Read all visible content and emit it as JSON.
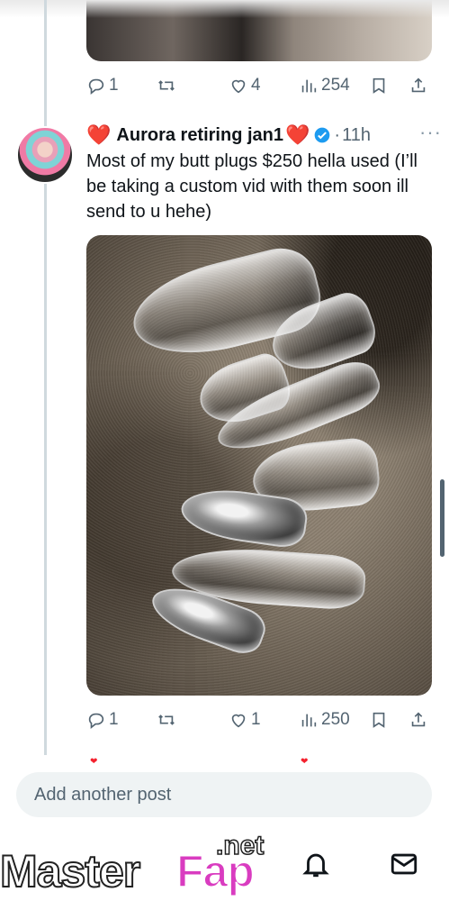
{
  "previous_post": {
    "replies": "1",
    "likes": "4",
    "views": "254"
  },
  "post": {
    "display_name": "Aurora retiring jan1",
    "name_prefix_emoji": "❤️",
    "name_suffix_emoji": "❤️",
    "verified": true,
    "separator": "·",
    "time": "11h",
    "more": "···",
    "text": "Most of my butt plugs $250 hella used (I’ll be taking a custom vid with them soon ill send to u hehe)",
    "media_alt": "photo",
    "replies": "1",
    "likes": "1",
    "views": "250"
  },
  "compose": {
    "placeholder": "Add another post"
  },
  "icons": {
    "reply": "reply-icon",
    "repost": "repost-icon",
    "like": "heart-icon",
    "views": "views-icon",
    "bookmark": "bookmark-icon",
    "share": "share-icon",
    "notifications": "bell-icon",
    "messages": "mail-icon"
  },
  "watermark": {
    "part1": "Master",
    "part2": "Fap",
    "part3": ".net"
  },
  "colors": {
    "text": "#0f1419",
    "secondary": "#536471",
    "verified": "#1d9bf0",
    "heart": "#e0245e",
    "compose_bg": "#eff3f4"
  }
}
